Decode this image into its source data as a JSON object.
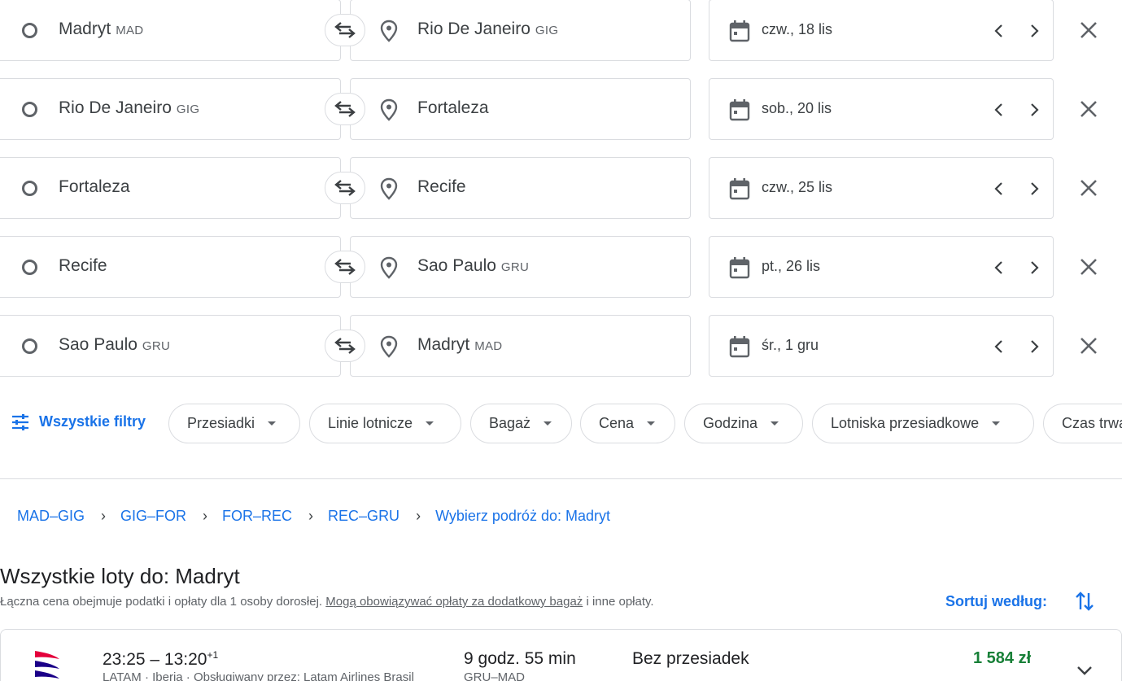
{
  "legs": [
    {
      "from_city": "Madryt",
      "from_code": "MAD",
      "to_city": "Rio De Janeiro",
      "to_code": "GIG",
      "date": "czw., 18 lis"
    },
    {
      "from_city": "Rio De Janeiro",
      "from_code": "GIG",
      "to_city": "Fortaleza",
      "to_code": "",
      "date": "sob., 20 lis"
    },
    {
      "from_city": "Fortaleza",
      "from_code": "",
      "to_city": "Recife",
      "to_code": "",
      "date": "czw., 25 lis"
    },
    {
      "from_city": "Recife",
      "from_code": "",
      "to_city": "Sao Paulo",
      "to_code": "GRU",
      "date": "pt., 26 lis"
    },
    {
      "from_city": "Sao Paulo",
      "from_code": "GRU",
      "to_city": "Madryt",
      "to_code": "MAD",
      "date": "śr., 1 gru"
    }
  ],
  "filters": {
    "all_label": "Wszystkie filtry",
    "chips": [
      "Przesiadki",
      "Linie lotnicze",
      "Bagaż",
      "Cena",
      "Godzina",
      "Lotniska przesiadkowe",
      "Czas trwania"
    ]
  },
  "breadcrumbs": [
    "MAD–GIG",
    "GIG–FOR",
    "FOR–REC",
    "REC–GRU",
    "Wybierz podróż do: Madryt"
  ],
  "results": {
    "title": "Wszystkie loty do: Madryt",
    "note_prefix": "Łączna cena obejmuje podatki i opłaty dla 1 osoby dorosłej. ",
    "note_link": "Mogą obowiązywać opłaty za dodatkowy bagaż",
    "note_suffix": " i inne opłaty.",
    "sort_label": "Sortuj według:"
  },
  "flight": {
    "times": "23:25 – 13:20",
    "day_offset": "+1",
    "airlines": "LATAM · Iberia · Obsługiwany przez: Latam Airlines Brasil",
    "duration": "9 godz. 55 min",
    "route": "GRU–MAD",
    "stops": "Bez przesiadek",
    "price": "1 584 zł"
  },
  "colors": {
    "accent": "#1a73e8",
    "price": "#188038",
    "border": "#dadce0"
  }
}
